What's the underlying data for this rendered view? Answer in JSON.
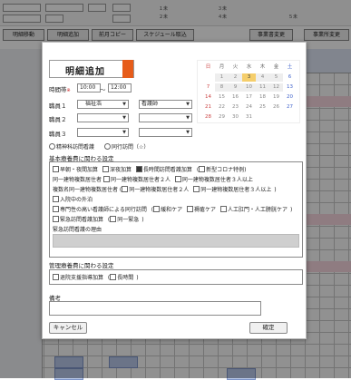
{
  "background": {
    "toolbar": [
      "明細移動",
      "明細追加",
      "前月コピー",
      "スケジュール取込"
    ],
    "right_buttons": [
      "事業書変更",
      "事業所変更"
    ],
    "radio_labels": [
      "１未",
      "２未",
      "３未",
      "４未",
      "５未"
    ],
    "small_values": [
      "1",
      "2",
      "3",
      "4"
    ]
  },
  "modal": {
    "title": "明細追加",
    "time_label": "時間帯",
    "time_required_mark": "※",
    "time_start": "10:00",
    "time_sep": "〜",
    "time_end": "12:00",
    "staff": [
      {
        "label": "職員１",
        "name": "福祉浩",
        "role": "看護師"
      },
      {
        "label": "職員２",
        "name": "",
        "role": ""
      },
      {
        "label": "職員３",
        "name": "",
        "role": ""
      }
    ],
    "visit_options": [
      "精神科訪問看護",
      "同行訪問（☆）"
    ],
    "calendar": {
      "headers": [
        "日",
        "月",
        "火",
        "水",
        "木",
        "金",
        "土"
      ],
      "weeks": [
        [
          "",
          "1",
          "2",
          "3",
          "4",
          "5",
          "6"
        ],
        [
          "7",
          "8",
          "9",
          "10",
          "11",
          "12",
          "13"
        ],
        [
          "14",
          "15",
          "16",
          "17",
          "18",
          "19",
          "20"
        ],
        [
          "21",
          "22",
          "23",
          "24",
          "25",
          "26",
          "27"
        ],
        [
          "28",
          "29",
          "30",
          "31",
          "",
          "",
          ""
        ]
      ],
      "selected": "3"
    },
    "basic_section": {
      "title": "基本療養費に関わる設定",
      "row1": [
        "早朝・夜間加算",
        "深夜加算",
        "長時間訪問看護加算",
        "新型コロナ特例"
      ],
      "row2_label": "同一建物複数居住者",
      "row2": [
        "同一建物複数居住者２人",
        "同一建物複数居住者３人以上"
      ],
      "row3_label": "複数名同一建物複数居住者",
      "row3": [
        "同一建物複数居住者２人",
        "同一建物複数居住者３人以上"
      ],
      "row4": "入院中の外泊",
      "row5": [
        "専門性の高い看護師による同行訪問",
        "緩和ケア",
        "褥瘡ケア",
        "人工肛門・人工膀胱ケア"
      ],
      "row6": [
        "緊急訪問看護加算",
        "同一緊急"
      ],
      "emergency_reason_label": "緊急訪問看護の理由"
    },
    "management_section": {
      "title": "管理療養費に関わる設定",
      "row1": [
        "退院支援指導加算",
        "長時間"
      ]
    },
    "remarks_label": "備考",
    "cancel_label": "キャンセル",
    "confirm_label": "確定"
  },
  "colors": {
    "title_tab": "#e65c1a",
    "calendar_highlight": "#f5ce6b",
    "overlay": "rgba(0,0,0,0.42)"
  }
}
